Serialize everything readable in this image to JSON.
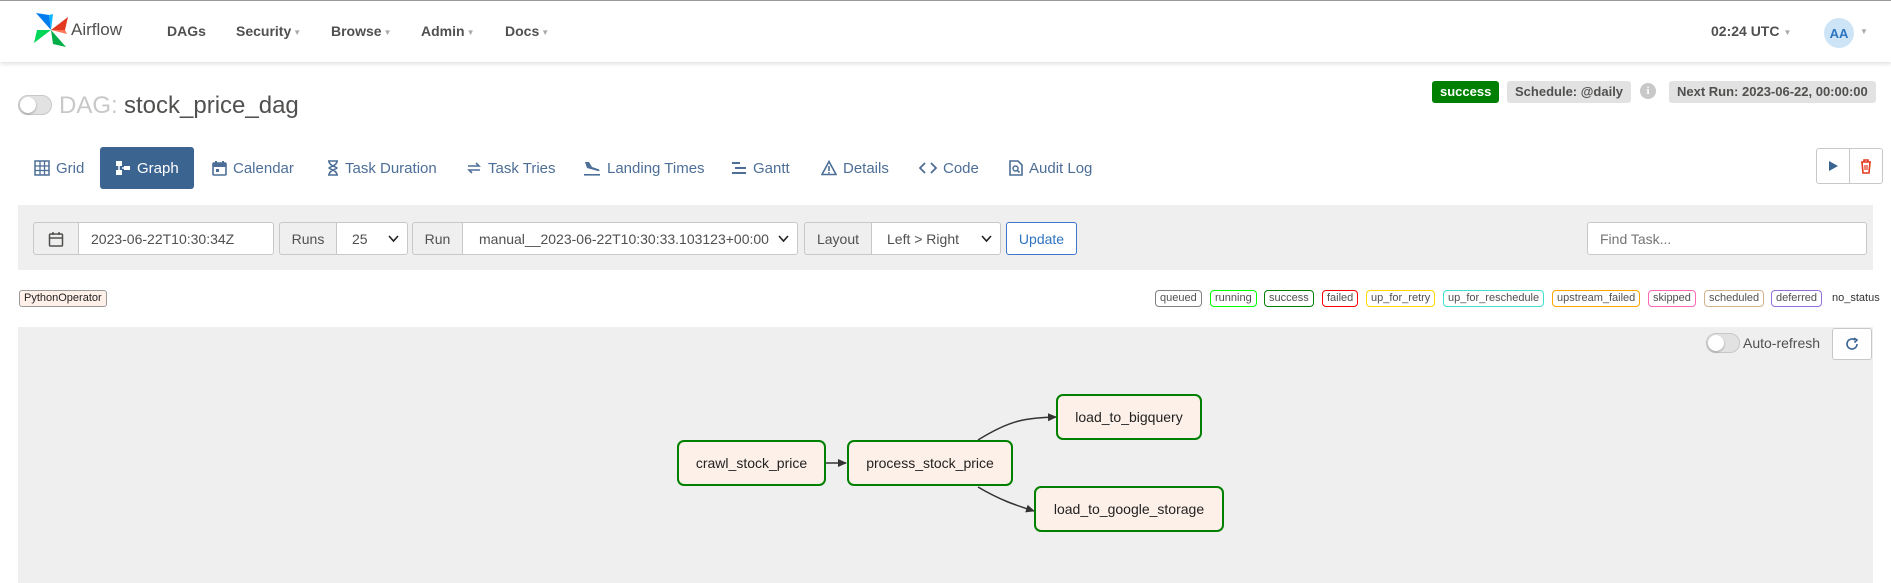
{
  "nav": {
    "brand": "Airflow",
    "items": [
      "DAGs",
      "Security",
      "Browse",
      "Admin",
      "Docs"
    ],
    "clock": "02:24 UTC",
    "avatar": "AA"
  },
  "header": {
    "dag_prefix": "DAG:",
    "dag_name": "stock_price_dag",
    "state": "success",
    "schedule": "Schedule: @daily",
    "info_icon": "i",
    "next_run": "Next Run: 2023-06-22, 00:00:00"
  },
  "tabs": [
    "Grid",
    "Graph",
    "Calendar",
    "Task Duration",
    "Task Tries",
    "Landing Times",
    "Gantt",
    "Details",
    "Code",
    "Audit Log"
  ],
  "filters": {
    "date": "2023-06-22T10:30:34Z",
    "runs_label": "Runs",
    "runs_value": "25",
    "run_label": "Run",
    "run_value": "manual__2023-06-22T10:30:33.103123+00:00",
    "layout_label": "Layout",
    "layout_value": "Left > Right",
    "update": "Update",
    "find_placeholder": "Find Task..."
  },
  "legend": {
    "operator": "PythonOperator",
    "states": [
      {
        "label": "queued",
        "color": "#808080"
      },
      {
        "label": "running",
        "color": "#00ff00"
      },
      {
        "label": "success",
        "color": "#008000"
      },
      {
        "label": "failed",
        "color": "#ff0000"
      },
      {
        "label": "up_for_retry",
        "color": "#ffd700"
      },
      {
        "label": "up_for_reschedule",
        "color": "#40e0d0"
      },
      {
        "label": "upstream_failed",
        "color": "#ffa500"
      },
      {
        "label": "skipped",
        "color": "#ff69b4"
      },
      {
        "label": "scheduled",
        "color": "#d2b48c"
      },
      {
        "label": "deferred",
        "color": "#9370db"
      }
    ],
    "no_status": "no_status"
  },
  "graph": {
    "auto_refresh": "Auto-refresh",
    "tasks": [
      "crawl_stock_price",
      "process_stock_price",
      "load_to_bigquery",
      "load_to_google_storage"
    ]
  },
  "colors": {
    "accent": "#3b6590",
    "link": "#4d6e96",
    "success": "#008000",
    "node_fill": "#fdf0e8"
  }
}
